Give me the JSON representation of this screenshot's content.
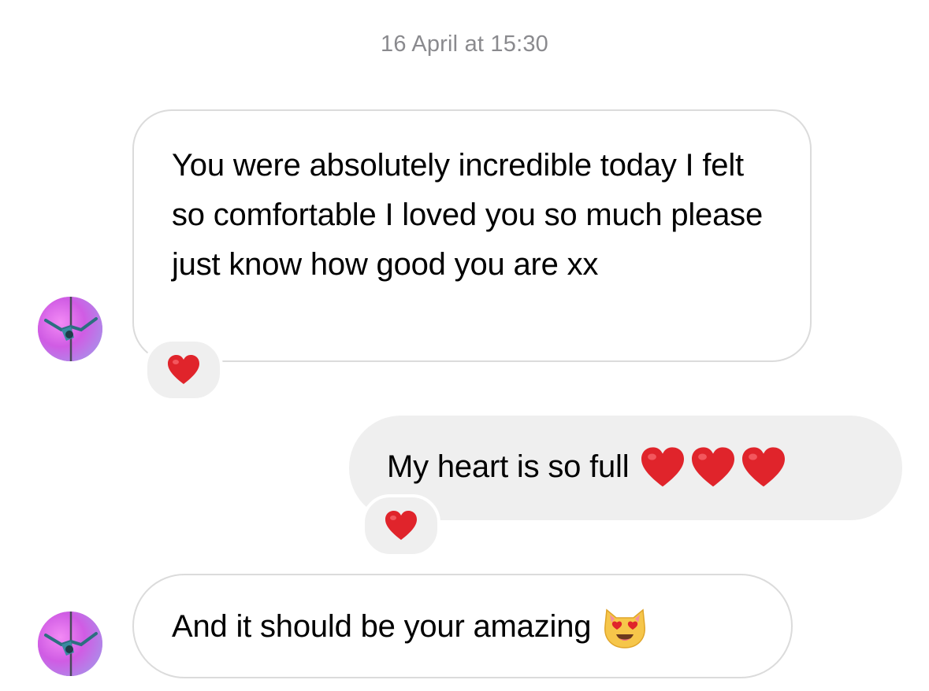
{
  "conversation": {
    "timestamp": "16 April at 15:30",
    "messages": [
      {
        "direction": "incoming",
        "text": "You were absolutely incredible today I felt so comfortable I loved you so much please just know how good you are xx",
        "reaction": "heart-emoji"
      },
      {
        "direction": "outgoing",
        "text": "My heart is so full",
        "trailing_emoji": [
          "heart-emoji",
          "heart-emoji",
          "heart-emoji"
        ],
        "reaction": "heart-emoji"
      },
      {
        "direction": "incoming",
        "text": "And it should be your amazing",
        "trailing_emoji": [
          "heart-eyes-cat-emoji"
        ]
      }
    ]
  },
  "colors": {
    "incoming_border": "#dbdbdb",
    "outgoing_bubble": "#efefef",
    "timestamp": "#8a8a8e",
    "heart": "#e0242b",
    "avatar_gradient": [
      "#f07cf0",
      "#b56fe8"
    ]
  },
  "icons": {
    "avatar": "pole-dancer-avatar",
    "reaction": "heart-emoji",
    "cat": "heart-eyes-cat-emoji"
  }
}
